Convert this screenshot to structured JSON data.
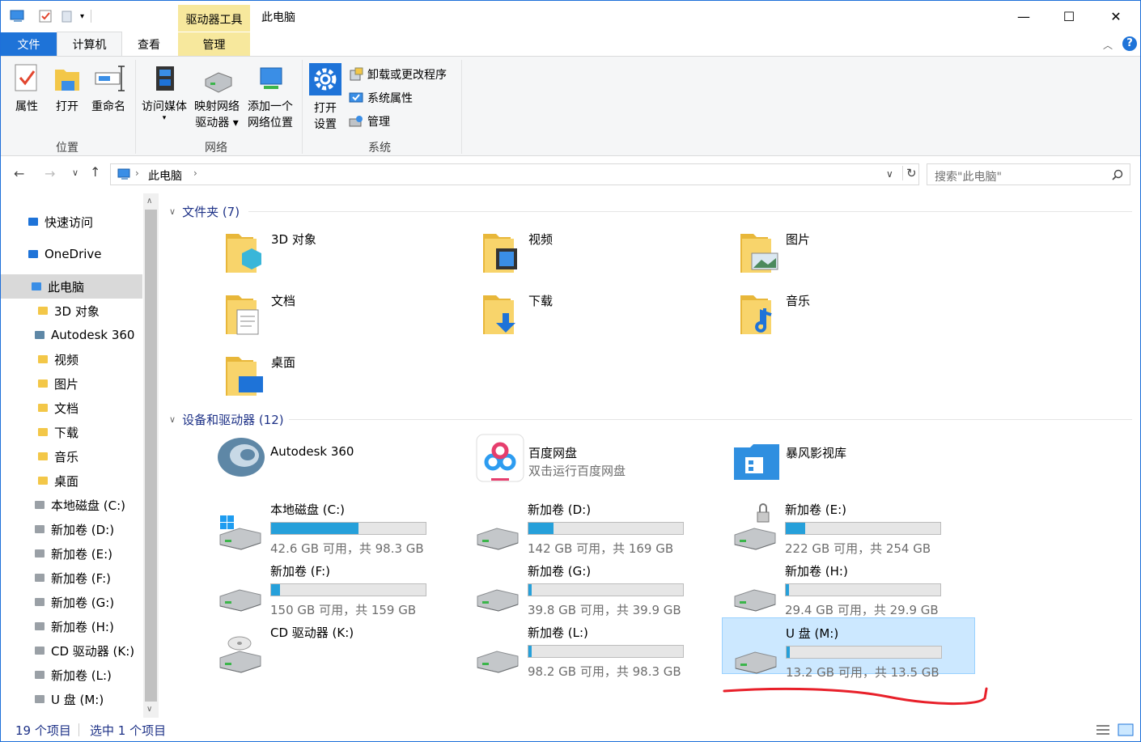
{
  "window": {
    "title": "此电脑",
    "contextual_tab": "驱动器工具",
    "minimize": "—",
    "maximize": "☐",
    "close": "✕"
  },
  "tabs": {
    "file": "文件",
    "computer": "计算机",
    "view": "查看",
    "manage": "管理"
  },
  "ribbon": {
    "location": {
      "label": "位置",
      "properties": "属性",
      "open": "打开",
      "rename": "重命名"
    },
    "network": {
      "label": "网络",
      "media": "访问媒体",
      "map_drive_1": "映射网络",
      "map_drive_2": "驱动器",
      "add_location_1": "添加一个",
      "add_location_2": "网络位置"
    },
    "system": {
      "label": "系统",
      "open_settings_1": "打开",
      "open_settings_2": "设置",
      "uninstall": "卸载或更改程序",
      "sys_props": "系统属性",
      "manage": "管理"
    }
  },
  "address": {
    "path": "此电脑",
    "search_placeholder": "搜索\"此电脑\""
  },
  "sidebar": {
    "items": [
      {
        "label": "快速访问",
        "icon": "star-icon"
      },
      {
        "label": "OneDrive",
        "icon": "cloud-icon"
      },
      {
        "label": "此电脑",
        "icon": "pc-icon"
      },
      {
        "label": "3D 对象",
        "icon": "3d-icon"
      },
      {
        "label": "Autodesk 360",
        "icon": "autodesk-icon"
      },
      {
        "label": "视频",
        "icon": "video-icon"
      },
      {
        "label": "图片",
        "icon": "picture-icon"
      },
      {
        "label": "文档",
        "icon": "document-icon"
      },
      {
        "label": "下载",
        "icon": "download-icon"
      },
      {
        "label": "音乐",
        "icon": "music-icon"
      },
      {
        "label": "桌面",
        "icon": "desktop-icon"
      },
      {
        "label": "本地磁盘 (C:)",
        "icon": "drive-c-icon"
      },
      {
        "label": "新加卷 (D:)",
        "icon": "drive-icon"
      },
      {
        "label": "新加卷 (E:)",
        "icon": "drive-locked-icon"
      },
      {
        "label": "新加卷 (F:)",
        "icon": "drive-icon"
      },
      {
        "label": "新加卷 (G:)",
        "icon": "drive-icon"
      },
      {
        "label": "新加卷 (H:)",
        "icon": "drive-icon"
      },
      {
        "label": "CD 驱动器 (K:)",
        "icon": "cd-icon"
      },
      {
        "label": "新加卷 (L:)",
        "icon": "drive-icon"
      },
      {
        "label": "U 盘 (M:)",
        "icon": "drive-icon"
      }
    ]
  },
  "folders": {
    "header": "文件夹 (7)",
    "items": [
      {
        "label": "3D 对象",
        "icon": "folder-3d-icon"
      },
      {
        "label": "视频",
        "icon": "folder-video-icon"
      },
      {
        "label": "图片",
        "icon": "folder-picture-icon"
      },
      {
        "label": "文档",
        "icon": "folder-document-icon"
      },
      {
        "label": "下载",
        "icon": "folder-download-icon"
      },
      {
        "label": "音乐",
        "icon": "folder-music-icon"
      },
      {
        "label": "桌面",
        "icon": "folder-desktop-icon"
      }
    ]
  },
  "devices": {
    "header": "设备和驱动器 (12)",
    "apps": [
      {
        "label": "Autodesk 360",
        "sub": ""
      },
      {
        "label": "百度网盘",
        "sub": "双击运行百度网盘"
      },
      {
        "label": "暴风影视库",
        "sub": ""
      }
    ],
    "drives": [
      {
        "label": "本地磁盘 (C:)",
        "size": "42.6 GB 可用，共 98.3 GB",
        "used": 0.567
      },
      {
        "label": "新加卷 (D:)",
        "size": "142 GB 可用，共 169 GB",
        "used": 0.16
      },
      {
        "label": "新加卷 (E:)",
        "size": "222 GB 可用，共 254 GB",
        "used": 0.126
      },
      {
        "label": "新加卷 (F:)",
        "size": "150 GB 可用，共 159 GB",
        "used": 0.057
      },
      {
        "label": "新加卷 (G:)",
        "size": "39.8 GB 可用，共 39.9 GB",
        "used": 0.003
      },
      {
        "label": "新加卷 (H:)",
        "size": "29.4 GB 可用，共 29.9 GB",
        "used": 0.017
      },
      {
        "label": "CD 驱动器 (K:)",
        "size": "",
        "used": null
      },
      {
        "label": "新加卷 (L:)",
        "size": "98.2 GB 可用，共 98.3 GB",
        "used": 0.001
      },
      {
        "label": "U 盘 (M:)",
        "size": "13.2 GB 可用，共 13.5 GB",
        "used": 0.022
      }
    ]
  },
  "status": {
    "count": "19 个项目",
    "selected": "选中 1 个项目"
  },
  "colors": {
    "accent": "#1e73d8",
    "bar_fill": "#26a0da",
    "selection": "#cce8ff",
    "annotation_red": "#e8202a"
  }
}
